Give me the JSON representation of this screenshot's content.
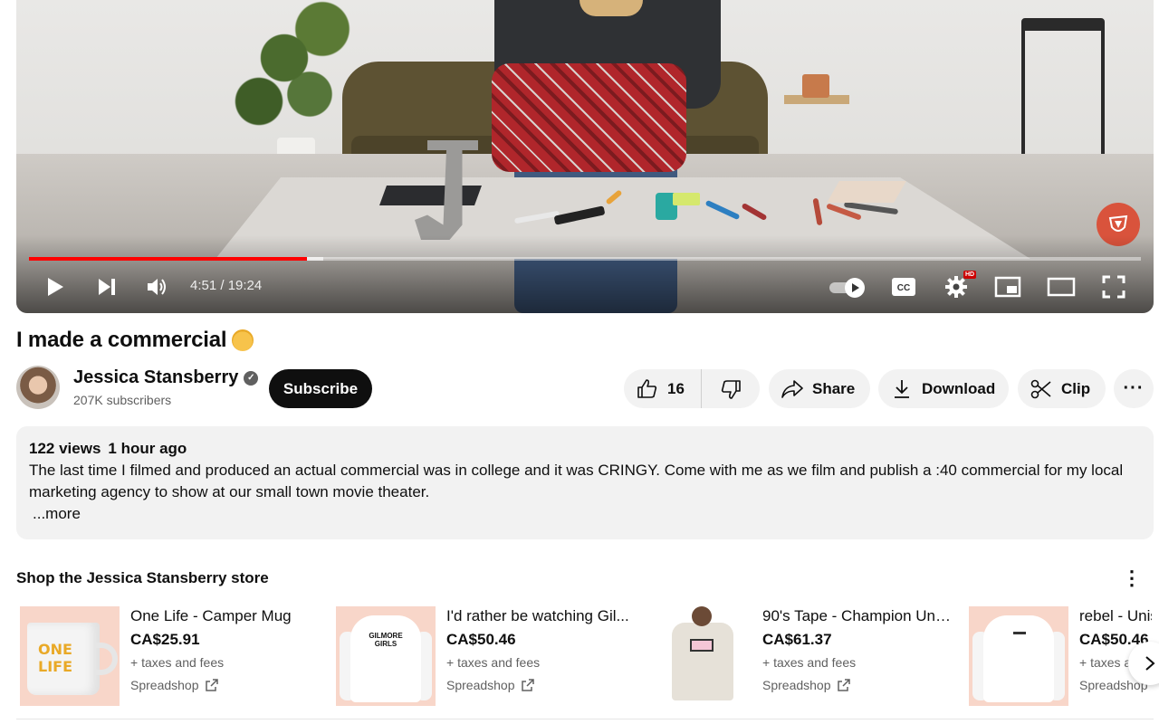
{
  "player": {
    "time_current": "4:51",
    "time_total": "19:24",
    "time_display": "4:51 / 19:24",
    "progress_played_fraction": 0.25,
    "progress_loaded_fraction": 0.265,
    "hd_badge": "HD",
    "icons": [
      "play-icon",
      "next-icon",
      "volume-icon",
      "autoplay-toggle-icon",
      "captions-icon",
      "settings-icon",
      "miniplayer-icon",
      "theater-icon",
      "fullscreen-icon",
      "channel-watermark-icon"
    ],
    "accent_color": "#ff0000"
  },
  "video": {
    "title": "I made a commercial",
    "title_emoji": "🤯"
  },
  "channel": {
    "name": "Jessica Stansberry",
    "subscribers": "207K subscribers",
    "subscribe_label": "Subscribe",
    "verified_icon": "✓"
  },
  "actions": {
    "like_count": "16",
    "share_label": "Share",
    "download_label": "Download",
    "clip_label": "Clip",
    "more_label": "···"
  },
  "description": {
    "views": "122 views",
    "age": "1 hour ago",
    "text": "The last time I filmed and produced an actual commercial was in college and it was CRINGY. Come with me as we film and publish a :40 commercial for my local marketing agency to show at our small town movie theater.",
    "more_label": "...more"
  },
  "store": {
    "title": "Shop the Jessica Stansberry store",
    "kebab_label": "⋮",
    "products": [
      {
        "name": "One Life - Camper Mug",
        "price": "CA$25.91",
        "fees": "+ taxes and fees",
        "shop": "Spreadshop"
      },
      {
        "name": "I'd rather be watching Gil...",
        "price": "CA$50.46",
        "fees": "+ taxes and fees",
        "shop": "Spreadshop",
        "thumb_text": "GILMORE GIRLS"
      },
      {
        "name": "90's Tape - Champion Unis...",
        "price": "CA$61.37",
        "fees": "+ taxes and fees",
        "shop": "Spreadshop"
      },
      {
        "name": "rebel - Unis",
        "price": "CA$50.46",
        "fees": "+ taxes a",
        "shop": "Spreadshop"
      }
    ],
    "mug_text": "ONE LIFE"
  }
}
